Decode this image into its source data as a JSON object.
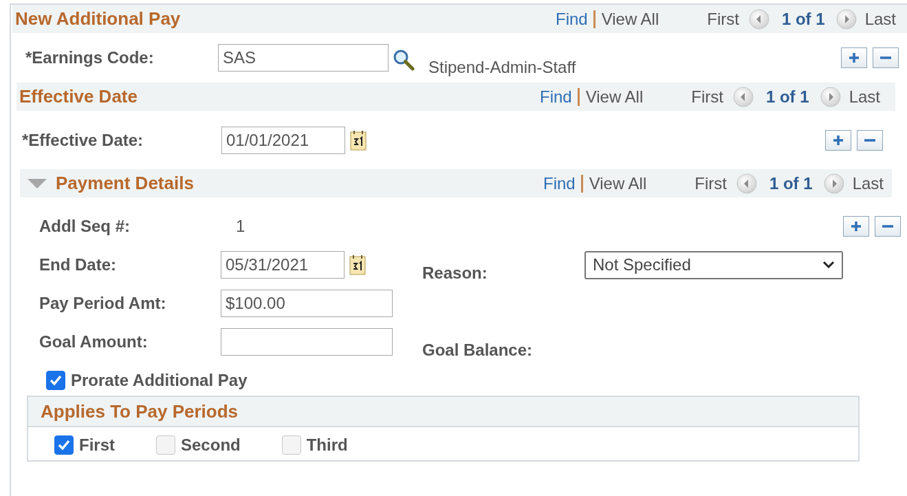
{
  "additional_pay": {
    "title": "New Additional Pay",
    "nav": {
      "find": "Find",
      "view_all": "View All",
      "first": "First",
      "count": "1 of 1",
      "last": "Last"
    },
    "fields": [
      {
        "kind": "lookup",
        "label": "*Earnings Code:",
        "value": "SAS",
        "description": "Stipend-Admin-Staff"
      }
    ]
  },
  "effective_date": {
    "title": "Effective Date",
    "nav": {
      "find": "Find",
      "view_all": "View All",
      "first": "First",
      "count": "1 of 1",
      "last": "Last"
    },
    "fields": [
      {
        "kind": "date",
        "label": "*Effective Date:",
        "value": "01/01/2021"
      }
    ]
  },
  "payment_details": {
    "title": "Payment Details",
    "expanded": true,
    "nav": {
      "find": "Find",
      "view_all": "View All",
      "first": "First",
      "count": "1 of 1",
      "last": "Last"
    },
    "rows": [
      [
        {
          "kind": "static",
          "label": "Addl Seq #:",
          "value": "1"
        }
      ],
      [
        {
          "kind": "date",
          "label": "End Date:",
          "value": "05/31/2021"
        },
        {
          "kind": "select",
          "label": "Reason:",
          "value": "Not Specified"
        }
      ],
      [
        {
          "kind": "text",
          "label": "Pay Period Amt:",
          "value": "$100.00"
        }
      ],
      [
        {
          "kind": "text",
          "label": "Goal Amount:"
        },
        {
          "kind": "static",
          "label": "Goal Balance:"
        }
      ]
    ],
    "prorate": {
      "label": "Prorate Additional Pay",
      "checked": true
    },
    "pay_periods": {
      "title": "Applies To Pay Periods",
      "options": [
        {
          "label": "First",
          "checked": true
        },
        {
          "label": "Second",
          "checked": false
        },
        {
          "label": "Third",
          "checked": false
        }
      ]
    }
  }
}
